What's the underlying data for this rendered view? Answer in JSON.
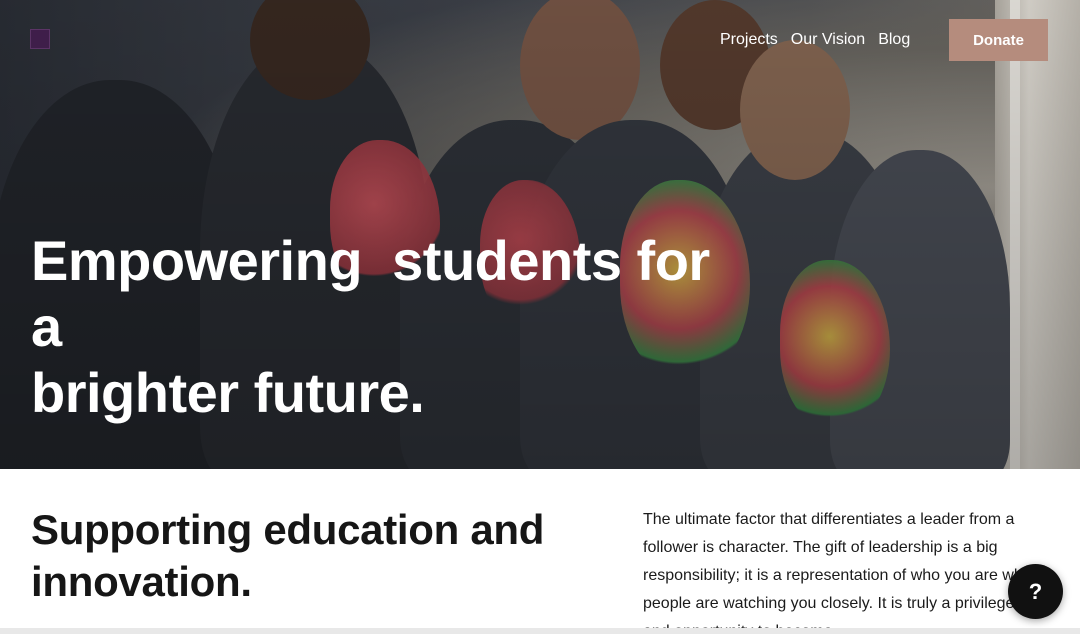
{
  "colors": {
    "accent": "#b58c7d",
    "logo": "#3f1e4a",
    "help_button": "#111111"
  },
  "header": {
    "logo_icon": "brand-logo-icon",
    "nav": [
      {
        "label": "Projects"
      },
      {
        "label": "Our Vision"
      },
      {
        "label": "Blog"
      }
    ],
    "donate_label": "Donate"
  },
  "hero": {
    "image": "photo of students in hoodies with colorful shirts",
    "title": "Empowering  students for a\nbrighter future."
  },
  "intro": {
    "title": "Supporting education and innovation.",
    "body": "The ultimate factor that differentiates a leader from a follower is character. The gift of leadership is a big responsibility; it is a representation of who you are when people are watching you closely. It is truly a privilege and opportunity to become"
  },
  "help": {
    "icon": "question-icon",
    "label": "?"
  }
}
